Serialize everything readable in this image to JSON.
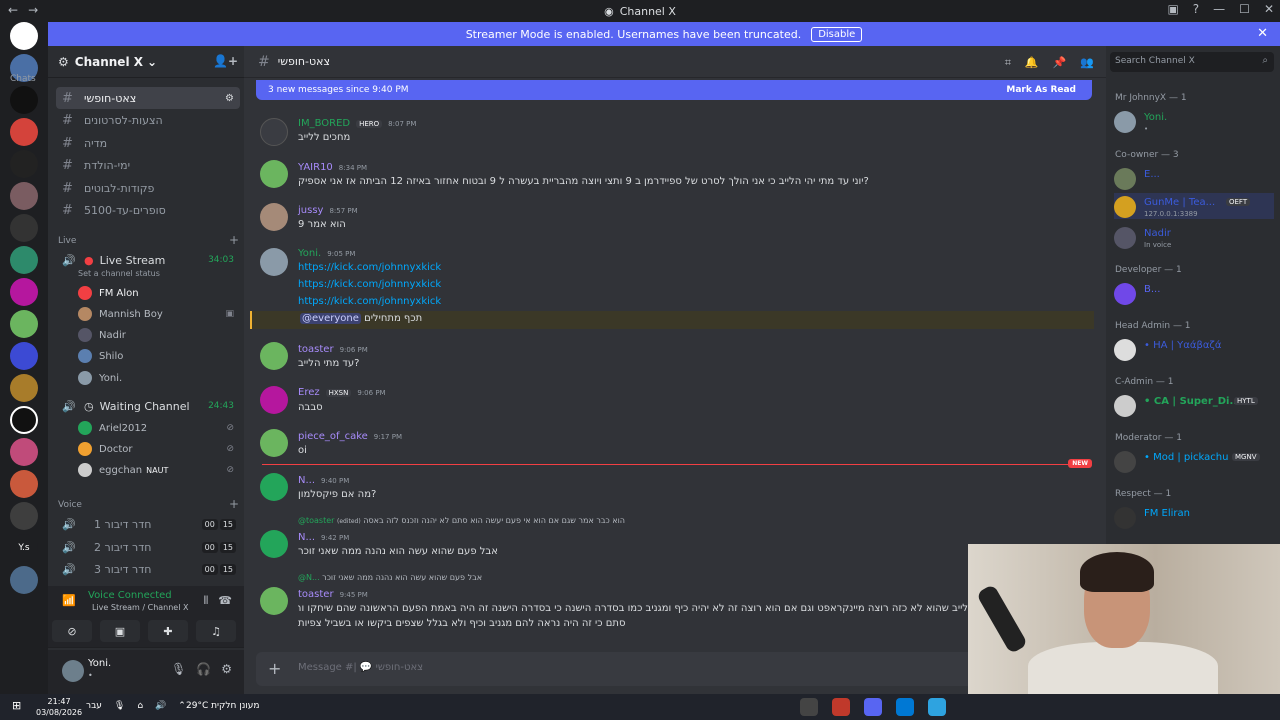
{
  "window": {
    "title": "Channel X"
  },
  "banner": {
    "text": "Streamer Mode is enabled. Usernames have been truncated.",
    "button": "Disable"
  },
  "server": {
    "name": "Channel X"
  },
  "sidebar": {
    "cat_chats": "Chats",
    "channels": [
      {
        "name": "צאט-חופשי"
      },
      {
        "name": "הצעות-לסרטונים"
      },
      {
        "name": "מדיה"
      },
      {
        "name": "ימי-הולדת"
      },
      {
        "name": "פקודות-לבוטים"
      },
      {
        "name": "סופרים-עד-5100"
      }
    ],
    "cat_live": "Live",
    "live": {
      "name": "Live Stream",
      "timer": "34:03",
      "status": "Set a channel status",
      "users": [
        "FM Alon",
        "Mannish Boy",
        "Nadir",
        "Shilo",
        "Yoni."
      ]
    },
    "waiting": {
      "name": "Waiting Channel",
      "timer": "24:43",
      "users": [
        "Ariel2012",
        "Doctor",
        "eggchan"
      ],
      "eggchan_badge": "NAUT"
    },
    "cat_voice": "Voice",
    "voice": [
      {
        "name": "חדר דיבור 1",
        "c1": "00",
        "c2": "15"
      },
      {
        "name": "חדר דיבור 2",
        "c1": "00",
        "c2": "15"
      },
      {
        "name": "חדר דיבור 3",
        "c1": "00",
        "c2": "15"
      }
    ]
  },
  "voice_status": {
    "title": "Voice Connected",
    "sub": "Live Stream / Channel X"
  },
  "user": {
    "name": "Yoni.",
    "status": "•"
  },
  "chat": {
    "channel": "צאט-חופשי",
    "new_bar": "3 new messages since 9:40 PM",
    "mark_read": "Mark As Read",
    "messages": [
      {
        "author": "IM_BORED",
        "time": "8:07 PM",
        "tag": "HERO",
        "text": "מחכים ללייב",
        "color": "#23a55a"
      },
      {
        "author": "YAIR10",
        "time": "8:34 PM",
        "text": "יוני עד מתי יהי הלייב כי אני הולך לסרט של ספיידרמן ב 9 ותצי ויוצה מהבריית בעשרה ל 9 ובטוח אחזור באיזה 12 הביתה אז אני אספיק?",
        "color": "#a78bfa"
      },
      {
        "author": "jussy",
        "time": "8:57 PM",
        "text": "הוא אמר 9",
        "color": "#a78bfa"
      },
      {
        "author": "Yoni.",
        "time": "9:05 PM",
        "links": [
          "https://kick.com/johnnyxkick",
          "https://kick.com/johnnyxkick",
          "https://kick.com/johnnyxkick"
        ],
        "color": "#23a55a"
      },
      {
        "mention": "@everyone",
        "text": "תכף מתחילים"
      },
      {
        "author": "toaster",
        "time": "9:06 PM",
        "text": "עד מתי הלייב?",
        "color": "#a78bfa"
      },
      {
        "author": "Erez",
        "time": "9:06 PM",
        "tag": "HXSN",
        "text": "סבבה",
        "color": "#a78bfa"
      },
      {
        "author": "piece_of_cake",
        "time": "9:17 PM",
        "text": "oi",
        "color": "#a78bfa"
      },
      {
        "author": "N...",
        "time": "9:40 PM",
        "text": "מה אם פיקסלמון?",
        "color": "#a78bfa"
      },
      {
        "reply_to": "@toaster",
        "reply_edited": "(edited)",
        "reply_text": "הוא כבר אמר שגם אם הוא אי פעם יעשה הוא סתם לא יהנה וזכנס לזה באסה",
        "author": "N...",
        "time": "9:42 PM",
        "text": "אבל פעם שהוא עשה הוא נהנה ממה שאני זוכר",
        "color": "#a78bfa"
      },
      {
        "reply_to": "@N...",
        "reply_text": "אבל פעם שהוא עשה הוא נהנה ממה שאני זוכר",
        "author": "toaster",
        "time": "9:45 PM",
        "text": "לייב שהוא לא כזה רוצה מיינקראפט וגם אם הוא רוצה זה לא יהיה כיף ומגניב כמו בסדרה הישנה כי בסדרה הישנה זה היה באמת הפעם הראשונה שהם שיחקו והם שיחקו",
        "text2": "סתם כי זה היה נראה להם מגניב וכיף ולא בגלל שצפים ביקשו או בשביל צפיות",
        "color": "#a78bfa"
      }
    ],
    "new_label": "NEW",
    "composer_placeholder": "Message #| 💬 צאט-חופשי"
  },
  "search": {
    "placeholder": "Search Channel X"
  },
  "members": [
    {
      "role": "Mr JohnnyX — 1",
      "list": [
        {
          "name": "Yoni.",
          "color": "#23a55a",
          "sub": "•"
        }
      ]
    },
    {
      "role": "Co-owner — 3",
      "list": [
        {
          "name": "E...",
          "color": "#3b5bdb",
          "sub": ""
        },
        {
          "name": "GunMe | Tea...",
          "color": "#3b5bdb",
          "sub": "127.0.0.1:3389",
          "tag": "OEFT"
        },
        {
          "name": "Nadir",
          "color": "#3b5bdb",
          "sub": "In voice"
        }
      ]
    },
    {
      "role": "Developer — 1",
      "list": [
        {
          "name": "B...",
          "color": "#5865f2",
          "sub": ""
        }
      ]
    },
    {
      "role": "Head Admin — 1",
      "list": [
        {
          "name": "• HA | Υαάβαζά",
          "color": "#3b5bdb",
          "sub": ""
        }
      ]
    },
    {
      "role": "C-Admin — 1",
      "list": [
        {
          "name": "• CA | Super_Di...",
          "color": "#23a55a",
          "sub": "",
          "tag": "HYTL"
        }
      ]
    },
    {
      "role": "Moderator — 1",
      "list": [
        {
          "name": "• Mod | pickachu",
          "color": "#00a8fc",
          "sub": "",
          "tag": "MGNV"
        }
      ]
    },
    {
      "role": "Respect — 1",
      "list": [
        {
          "name": "FM Eliran",
          "color": "#00a8fc",
          "sub": ""
        }
      ]
    }
  ],
  "taskbar": {
    "time": "21:47",
    "date": "03/08/2026",
    "lang": "עבר",
    "weather": "29°C  מעונן חלקית"
  }
}
